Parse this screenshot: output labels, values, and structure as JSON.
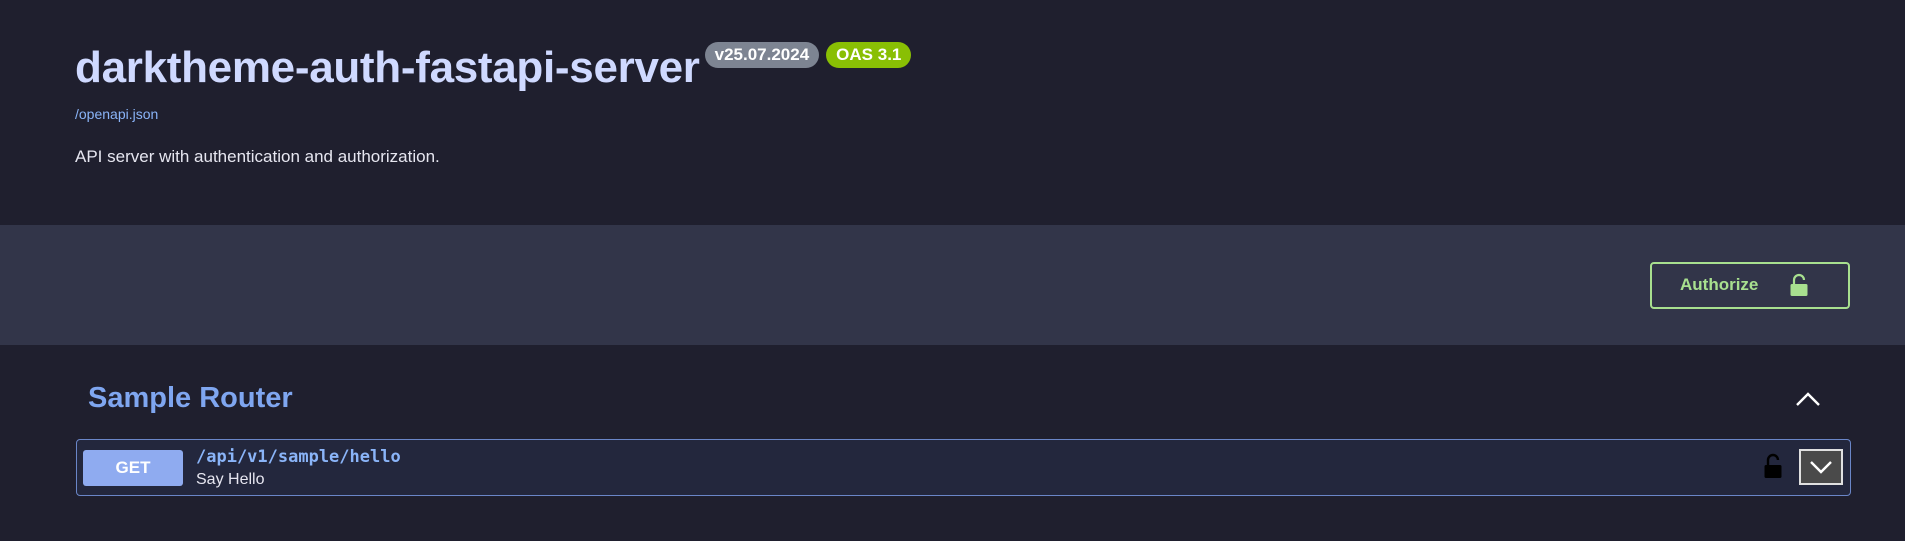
{
  "info": {
    "title": "darktheme-auth-fastapi-server",
    "version_badge": "v25.07.2024",
    "oas_badge": "OAS 3.1",
    "spec_link": "/openapi.json",
    "description": "API server with authentication and authorization."
  },
  "scheme": {
    "authorize_label": "Authorize",
    "authorize_icon": "unlocked-padlock-icon"
  },
  "tags": [
    {
      "name": "Sample Router",
      "toggle_icon": "chevron-up-icon",
      "operations": [
        {
          "method": "GET",
          "path": "/api/v1/sample/hello",
          "summary": "Say Hello",
          "lock_icon": "unlocked-padlock-icon",
          "expand_icon": "chevron-down-icon"
        }
      ]
    }
  ],
  "colors": {
    "background": "#1f1f2e",
    "scheme_background": "#323549",
    "title": "#cfd9ff",
    "link": "#8ab4f8",
    "authorize_green": "#a8e08f",
    "oas_green": "#89bf04",
    "version_gray": "#7d8492",
    "get_blue": "#8fabf0",
    "tag_blue": "#7fa6f0"
  }
}
